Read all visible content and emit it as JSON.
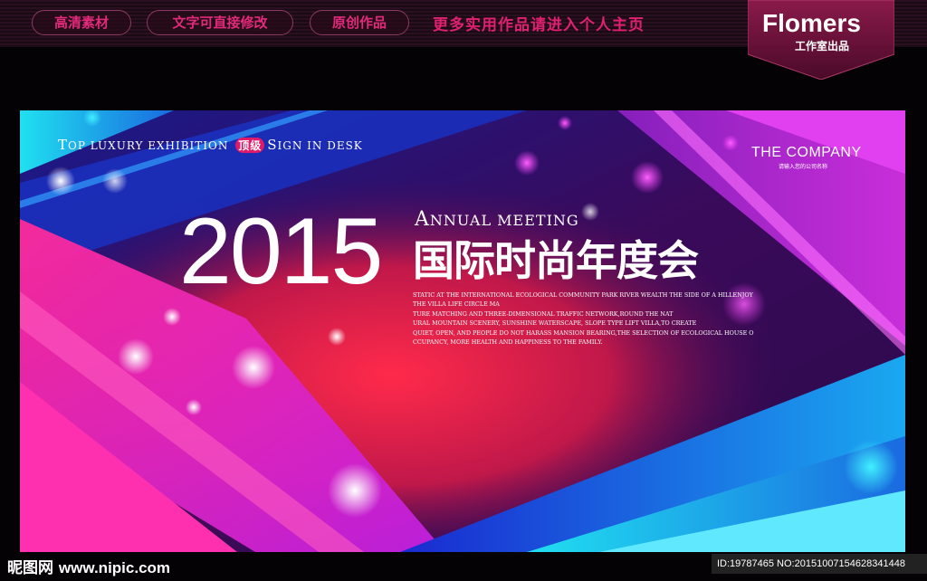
{
  "topbar": {
    "pills": [
      "高清素材",
      "文字可直接修改",
      "原创作品"
    ],
    "promo": "更多实用作品请进入个人主页",
    "brand_name": "Flomers",
    "brand_sub": "工作室出品"
  },
  "poster": {
    "top_line_1": "T",
    "top_line_1_rest": "OP LUXURY EXHIBITION",
    "badge": "顶级",
    "top_line_2": "S",
    "top_line_2_rest": "IGN IN DESK",
    "company": "THE COMPANY",
    "company_sub": "请输入您的公司名称",
    "year": "2015",
    "annual_cap": "A",
    "annual_rest": "NNUAL MEETING",
    "title_cn": "国际时尚年度会",
    "body_lines": [
      "STATIC AT THE INTERNATIONAL ECOLOGICAL COMMUNITY PARK RIVER WEALTH THE SIDE OF A HILLENJOY",
      "THE VILLA LIFE CIRCLE MA",
      "TURE MATCHING AND THREE-DIMENSIONAL TRAFFIC NETWORK,ROUND THE NAT",
      "URAL MOUNTAIN SCENERY, SUNSHINE WATERSCAPE, SLOPE TYPE LIFT VILLA,TO CREATE",
      "QUIET, OPEN, AND PEOPLE DO NOT HARASS MANSION BEARING,THE SELECTION OF ECOLOGICAL HOUSE O",
      "CCUPANCY, MORE HEALTH AND HAPPINESS TO THE FAMILY."
    ]
  },
  "footer": {
    "site_cn": "昵图网",
    "site_url": "www.nipic.com",
    "id_text": "ID:19787465 NO:20151007154628341448"
  },
  "colors": {
    "accent_pink": "#e01a6a",
    "bg_purple": "#3a0a5a",
    "cyan": "#20d8f0"
  }
}
